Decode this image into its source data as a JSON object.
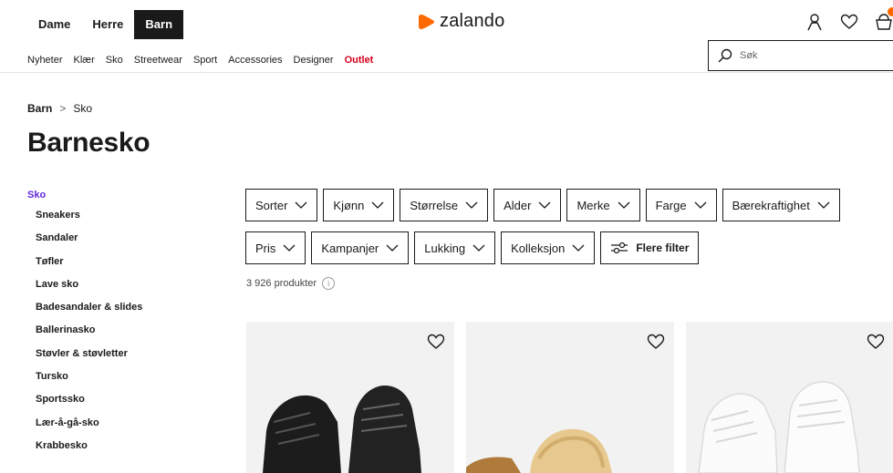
{
  "header": {
    "gender_tabs": [
      "Dame",
      "Herre",
      "Barn"
    ],
    "active_gender": "Barn",
    "logo_text": "zalando",
    "brand_color": "#ff6900"
  },
  "nav": {
    "items": [
      "Nyheter",
      "Klær",
      "Sko",
      "Streetwear",
      "Sport",
      "Accessories",
      "Designer",
      "Outlet"
    ],
    "outlet_color": "#d5001c"
  },
  "search": {
    "placeholder": "Søk"
  },
  "breadcrumb": {
    "root": "Barn",
    "separator": ">",
    "current": "Sko"
  },
  "page_title": "Barnesko",
  "sidebar": {
    "heading": "Sko",
    "items": [
      "Sneakers",
      "Sandaler",
      "Tøfler",
      "Lave sko",
      "Badesandaler & slides",
      "Ballerinasko",
      "Støvler & støvletter",
      "Tursko",
      "Sportssko",
      "Lær-å-gå-sko",
      "Krabbesko"
    ]
  },
  "filters": {
    "row1": [
      "Sorter",
      "Kjønn",
      "Størrelse",
      "Alder",
      "Merke",
      "Farge",
      "Bærekraftighet"
    ],
    "row2": [
      "Pris",
      "Kampanjer",
      "Lukking",
      "Kolleksjon"
    ],
    "more_label": "Flere filter"
  },
  "product_count": "3 926 produkter",
  "products": [
    {
      "image": "black-sneakers"
    },
    {
      "image": "tan-slippers-with-fur"
    },
    {
      "image": "white-sneakers"
    }
  ]
}
